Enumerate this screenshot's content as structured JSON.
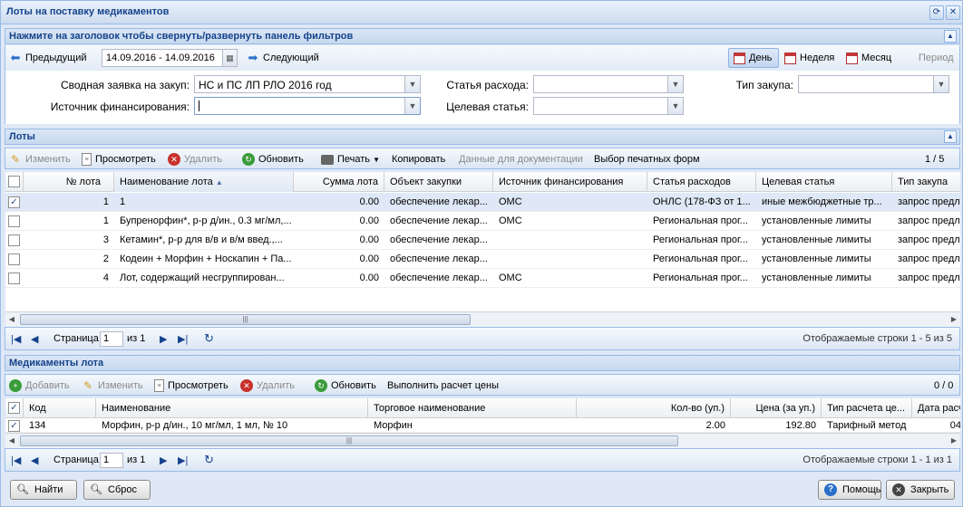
{
  "window": {
    "title": "Лоты на поставку медикаментов"
  },
  "filters_panel": {
    "title": "Нажмите на заголовок чтобы свернуть/развернуть панель фильтров",
    "prev_label": "Предыдущий",
    "next_label": "Следующий",
    "date_range": "14.09.2016 - 14.09.2016",
    "periods": [
      "День",
      "Неделя",
      "Месяц",
      "Период"
    ],
    "fields": {
      "request_label": "Сводная заявка на закуп:",
      "request_value": "НС и ПС ЛП РЛО 2016 год",
      "source_label": "Источник финансирования:",
      "source_value": "",
      "expense_label": "Статья расхода:",
      "expense_value": "",
      "target_label": "Целевая статья:",
      "target_value": "",
      "purchase_type_label": "Тип закупа:",
      "purchase_type_value": ""
    }
  },
  "lots_panel": {
    "title": "Лоты",
    "toolbar": {
      "edit": "Изменить",
      "view": "Просмотреть",
      "delete": "Удалить",
      "refresh": "Обновить",
      "print": "Печать",
      "copy": "Копировать",
      "docs_data": "Данные для документации",
      "print_forms": "Выбор печатных форм",
      "counter": "1 / 5"
    },
    "columns": [
      "№ лота",
      "Наименование лота",
      "Сумма лота",
      "Объект закупки",
      "Источник финансирования",
      "Статья расходов",
      "Целевая статья",
      "Тип закупа"
    ],
    "rows": [
      {
        "checked": true,
        "num": "1",
        "name": "1",
        "sum": "0.00",
        "object": "обеспечение лекар...",
        "source": "ОМС",
        "expense": "ОНЛС (178-ФЗ от 1...",
        "target": "иные межбюджетные тр...",
        "type": "запрос предл"
      },
      {
        "checked": false,
        "num": "1",
        "name": "Бупренорфин*, р-р д/ин., 0.3 мг/мл,...",
        "sum": "0.00",
        "object": "обеспечение лекар...",
        "source": "ОМС",
        "expense": "Региональная прог...",
        "target": "установленные лимиты",
        "type": "запрос предл"
      },
      {
        "checked": false,
        "num": "3",
        "name": "Кетамин*, р-р для в/в и в/м введ.,...",
        "sum": "0.00",
        "object": "обеспечение лекар...",
        "source": "",
        "expense": "Региональная прог...",
        "target": "установленные лимиты",
        "type": "запрос предл"
      },
      {
        "checked": false,
        "num": "2",
        "name": "Кодеин + Морфин + Носкапин + Па...",
        "sum": "0.00",
        "object": "обеспечение лекар...",
        "source": "",
        "expense": "Региональная прог...",
        "target": "установленные лимиты",
        "type": "запрос предл"
      },
      {
        "checked": false,
        "num": "4",
        "name": "Лот, содержащий несгруппирован...",
        "sum": "0.00",
        "object": "обеспечение лекар...",
        "source": "ОМС",
        "expense": "Региональная прог...",
        "target": "установленные лимиты",
        "type": "запрос предл"
      }
    ],
    "pager": {
      "page_label": "Страница",
      "page": "1",
      "of": "из 1",
      "status": "Отображаемые строки 1 - 5 из 5"
    }
  },
  "meds_panel": {
    "title": "Медикаменты лота",
    "toolbar": {
      "add": "Добавить",
      "edit": "Изменить",
      "view": "Просмотреть",
      "delete": "Удалить",
      "refresh": "Обновить",
      "calc": "Выполнить расчет цены",
      "counter": "0 / 0"
    },
    "columns": [
      "Код",
      "Наименование",
      "Торговое наименование",
      "Кол-во (уп.)",
      "Цена (за уп.)",
      "Тип расчета це...",
      "Дата расч"
    ],
    "rows": [
      {
        "checked": true,
        "code": "134",
        "name": "Морфин, р-р д/ин., 10 мг/мл, 1 мл, № 10",
        "trade": "Морфин",
        "qty": "2.00",
        "price": "192.80",
        "calc_type": "Тарифный метод",
        "date": "04"
      }
    ],
    "pager": {
      "page_label": "Страница",
      "page": "1",
      "of": "из 1",
      "status": "Отображаемые строки 1 - 1 из 1"
    }
  },
  "footer": {
    "find": "Найти",
    "reset": "Сброс",
    "help": "Помощь",
    "close": "Закрыть"
  }
}
